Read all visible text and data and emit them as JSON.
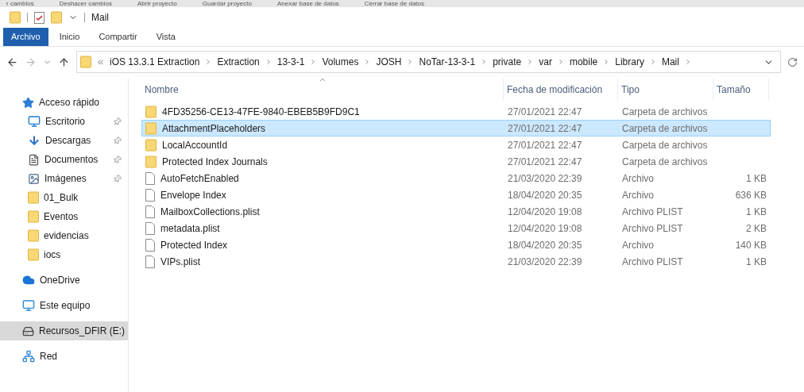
{
  "background_toolbar": [
    "r cambios",
    "Deshacer cambios",
    "Abrir proyecto",
    "Guardar proyecto",
    "Anexar base de datos",
    "Cerrar base de datos"
  ],
  "window": {
    "title": "Mail"
  },
  "tabs": [
    {
      "label": "Archivo",
      "selected": true
    },
    {
      "label": "Inicio",
      "selected": false
    },
    {
      "label": "Compartir",
      "selected": false
    },
    {
      "label": "Vista",
      "selected": false
    }
  ],
  "address_bar": {
    "path": [
      "iOS 13.3.1 Extraction",
      "Extraction",
      "13-3-1",
      "Volumes",
      "JOSH",
      "NoTar-13-3-1",
      "private",
      "var",
      "mobile",
      "Library",
      "Mail"
    ]
  },
  "sidebar": {
    "items": [
      {
        "label": "Acceso rápido",
        "kind": "star",
        "selected": false,
        "children": [
          {
            "label": "Escritorio",
            "kind": "desktop",
            "pinned": true,
            "selected": false
          },
          {
            "label": "Descargas",
            "kind": "download",
            "pinned": true,
            "selected": false
          },
          {
            "label": "Documentos",
            "kind": "documents",
            "pinned": true,
            "selected": false
          },
          {
            "label": "Imágenes",
            "kind": "images",
            "pinned": true,
            "selected": false
          },
          {
            "label": "01_Bulk",
            "kind": "folder",
            "pinned": false,
            "selected": false
          },
          {
            "label": "Eventos",
            "kind": "folder",
            "pinned": false,
            "selected": false
          },
          {
            "label": "evidencias",
            "kind": "folder",
            "pinned": false,
            "selected": false
          },
          {
            "label": "iocs",
            "kind": "folder",
            "pinned": false,
            "selected": false
          }
        ]
      },
      {
        "label": "OneDrive",
        "kind": "cloud",
        "selected": false
      },
      {
        "label": "Este equipo",
        "kind": "computer",
        "selected": false
      },
      {
        "label": "Recursos_DFIR (E:)",
        "kind": "drive",
        "selected": true
      },
      {
        "label": "Red",
        "kind": "network",
        "selected": false
      }
    ]
  },
  "table": {
    "columns": [
      {
        "label": "Nombre",
        "sorted": true
      },
      {
        "label": "Fecha de modificación",
        "sorted": false
      },
      {
        "label": "Tipo",
        "sorted": false
      },
      {
        "label": "Tamaño",
        "sorted": false
      }
    ],
    "rows": [
      {
        "kind": "folder",
        "name": "4FD35256-CE13-47FE-9840-EBEB5B9FD9C1",
        "date": "27/01/2021 22:47",
        "type": "Carpeta de archivos",
        "selected": false
      },
      {
        "kind": "folder",
        "name": "AttachmentPlaceholders",
        "date": "27/01/2021 22:47",
        "type": "Carpeta de archivos",
        "selected": true
      },
      {
        "kind": "folder",
        "name": "LocalAccountId",
        "date": "27/01/2021 22:47",
        "type": "Carpeta de archivos",
        "selected": false
      },
      {
        "kind": "folder",
        "name": "Protected Index Journals",
        "date": "27/01/2021 22:47",
        "type": "Carpeta de archivos",
        "selected": false
      },
      {
        "kind": "file",
        "name": "AutoFetchEnabled",
        "date": "21/03/2020 22:39",
        "type": "Archivo",
        "size": "1 KB",
        "selected": false
      },
      {
        "kind": "file",
        "name": "Envelope Index",
        "date": "18/04/2020 20:35",
        "type": "Archivo",
        "size": "636 KB",
        "selected": false
      },
      {
        "kind": "file",
        "name": "MailboxCollections.plist",
        "date": "12/04/2020 19:08",
        "type": "Archivo PLIST",
        "size": "1 KB",
        "selected": false
      },
      {
        "kind": "file",
        "name": "metadata.plist",
        "date": "12/04/2020 19:08",
        "type": "Archivo PLIST",
        "size": "2 KB",
        "selected": false
      },
      {
        "kind": "file",
        "name": "Protected Index",
        "date": "18/04/2020 20:35",
        "type": "Archivo",
        "size": "140 KB",
        "selected": false
      },
      {
        "kind": "file",
        "name": "VIPs.plist",
        "date": "21/03/2020 22:39",
        "type": "Archivo PLIST",
        "size": "1 KB",
        "selected": false
      }
    ]
  }
}
